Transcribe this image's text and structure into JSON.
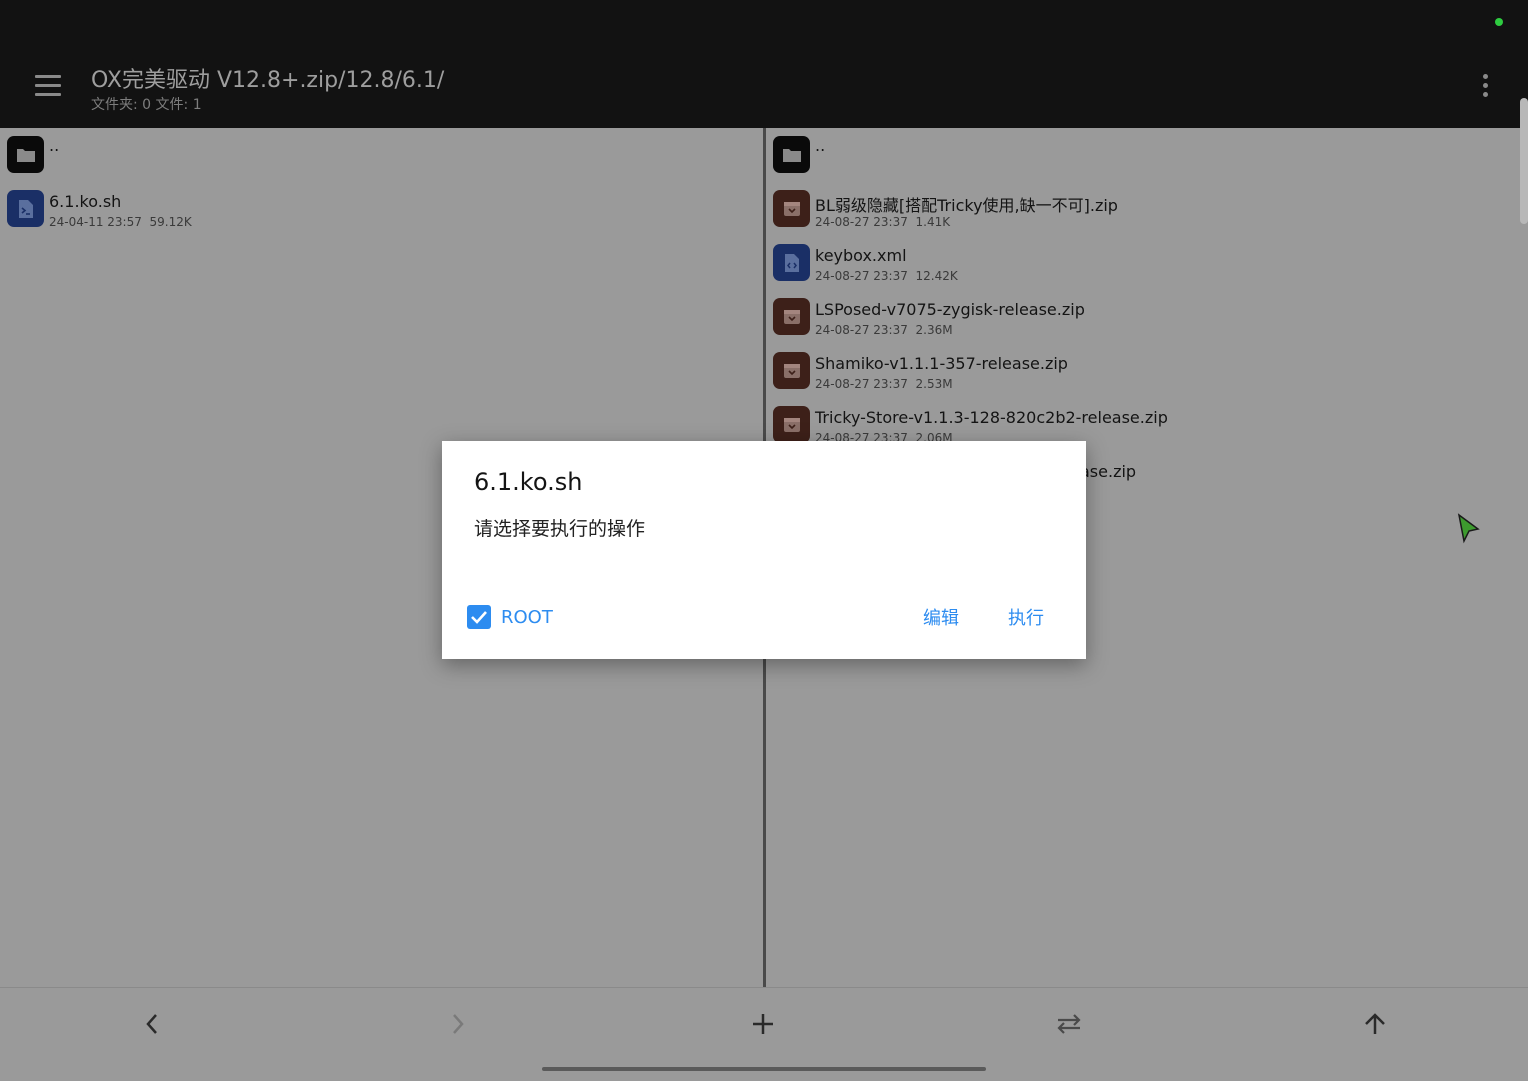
{
  "header": {
    "title": "OX完美驱动 V12.8+.zip/12.8/6.1/",
    "subtitle": "文件夹: 0  文件: 1"
  },
  "left_pane": {
    "parent_label": "..",
    "files": [
      {
        "name": "6.1.ko.sh",
        "date": "24-04-11 23:57",
        "size": "59.12K",
        "icon": "script-file-icon"
      }
    ]
  },
  "right_pane": {
    "parent_label": "..",
    "files": [
      {
        "name": "BL弱级隐藏[搭配Tricky使用,缺一不可].zip",
        "date": "24-08-27 23:37",
        "size": "1.41K",
        "icon": "archive-icon"
      },
      {
        "name": "keybox.xml",
        "date": "24-08-27 23:37",
        "size": "12.42K",
        "icon": "code-file-icon"
      },
      {
        "name": "LSPosed-v7075-zygisk-release.zip",
        "date": "24-08-27 23:37",
        "size": "2.36M",
        "icon": "archive-icon"
      },
      {
        "name": "Shamiko-v1.1.1-357-release.zip",
        "date": "24-08-27 23:37",
        "size": "2.53M",
        "icon": "archive-icon"
      },
      {
        "name": "Tricky-Store-v1.1.3-128-820c2b2-release.zip",
        "date": "24-08-27 23:37",
        "size": "2.06M",
        "icon": "archive-icon"
      },
      {
        "name": "ase.zip",
        "date": "",
        "size": "",
        "icon": ""
      }
    ]
  },
  "dialog": {
    "title": "6.1.ko.sh",
    "message": "请选择要执行的操作",
    "checkbox_label": "ROOT",
    "checkbox_checked": true,
    "edit_label": "编辑",
    "execute_label": "执行"
  },
  "bottom_nav": [
    "back-icon",
    "forward-icon",
    "add-icon",
    "swap-icon",
    "up-icon"
  ],
  "colors": {
    "accent": "#2d8cf0",
    "topbar": "#121212",
    "status_dot": "#2ecc40"
  }
}
